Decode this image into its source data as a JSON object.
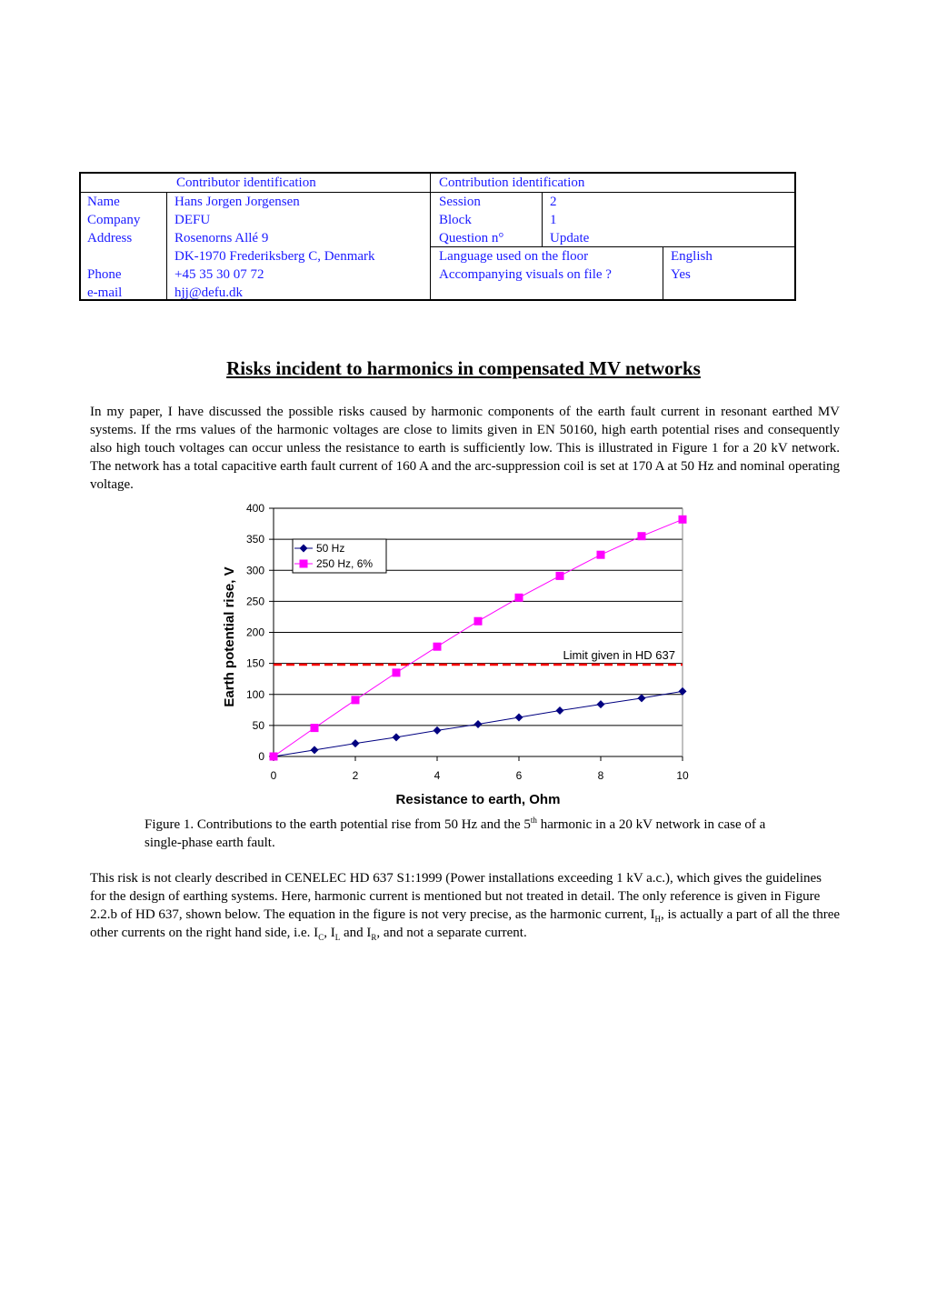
{
  "header_table": {
    "contributor_heading": "Contributor identification",
    "contribution_heading": "Contribution identification",
    "contributor_rows": [
      {
        "label": "Name",
        "value": "Hans Jorgen Jorgensen"
      },
      {
        "label": "Company",
        "value": "DEFU"
      },
      {
        "label": "Address",
        "value": "Rosenorns Allé 9"
      },
      {
        "label": "",
        "value": "DK-1970 Frederiksberg C, Denmark"
      },
      {
        "label": "Phone",
        "value": "+45 35 30 07 72"
      },
      {
        "label": "e-mail",
        "value": "hjj@defu.dk"
      }
    ],
    "contribution_rows": [
      {
        "label": "Session",
        "value": "2"
      },
      {
        "label": "Block",
        "value": "1"
      },
      {
        "label": "Question n°",
        "value": "Update"
      }
    ],
    "floor_rows": [
      {
        "label": "Language used on the floor",
        "value": "English"
      },
      {
        "label": "Accompanying visuals on file ?",
        "value": "Yes"
      }
    ]
  },
  "title": "Risks incident to harmonics in compensated MV networks",
  "intro_paragraph": "In my paper, I have discussed the possible risks caused by harmonic components of the earth fault current in resonant earthed MV systems. If the rms values of the harmonic voltages are close to limits given in EN 50160, high earth potential rises and consequently also high touch voltages can occur unless the resistance to earth is sufficiently low. This is illustrated in Figure 1 for a 20 kV network. The network has a total capacitive earth fault current of 160 A and the arc-suppression coil is set at 170 A at 50 Hz and nominal operating voltage.",
  "caption": {
    "prefix": "Figure 1. Contributions to the earth potential rise from 50 Hz and the 5",
    "sup": "th",
    "suffix": " harmonic in a 20 kV network in case of a single-phase earth fault."
  },
  "second_paragraph": {
    "part1": "This risk is not clearly described in CENELEC HD 637 S1:1999 (Power installations exceeding 1 kV a.c.), which gives the guidelines for the design of earthing systems. Here, harmonic current is mentioned but not treated in detail. The only reference is given in Figure 2.2.b of HD 637, shown below. The equation in the figure is not very precise, as the harmonic current, I",
    "sub_h": "H",
    "part2": ", is actually a part of all the three other currents on the right hand side, i.e. I",
    "sub_c": "C",
    "part3": ", I",
    "sub_l": "L",
    "part4": " and I",
    "sub_r": "R",
    "part5": ", and not a separate current."
  },
  "chart_data": {
    "type": "line",
    "title": "",
    "xlabel": "Resistance to earth, Ohm",
    "ylabel": "Earth potential rise,  V",
    "x": [
      0,
      1,
      2,
      3,
      4,
      5,
      6,
      7,
      8,
      9,
      10
    ],
    "xlim": [
      0,
      10
    ],
    "ylim": [
      0,
      400
    ],
    "xticks": [
      0,
      2,
      4,
      6,
      8,
      10
    ],
    "yticks": [
      0,
      50,
      100,
      150,
      200,
      250,
      300,
      350,
      400
    ],
    "grid": "horizontal",
    "legend_position": "top-left",
    "series": [
      {
        "name": "50 Hz",
        "marker": "diamond",
        "color": "#000080",
        "values": [
          0,
          10.5,
          21,
          31,
          42,
          52,
          63,
          74,
          84,
          94,
          105
        ]
      },
      {
        "name": "250 Hz, 6%",
        "marker": "square",
        "color": "#ff00ff",
        "values": [
          0,
          46,
          91,
          135,
          177,
          218,
          256,
          291,
          325,
          355,
          382
        ]
      }
    ],
    "reference_line": {
      "y": 148,
      "label": "Limit given in HD 637",
      "color": "#ff0000",
      "style": "dashed"
    }
  }
}
